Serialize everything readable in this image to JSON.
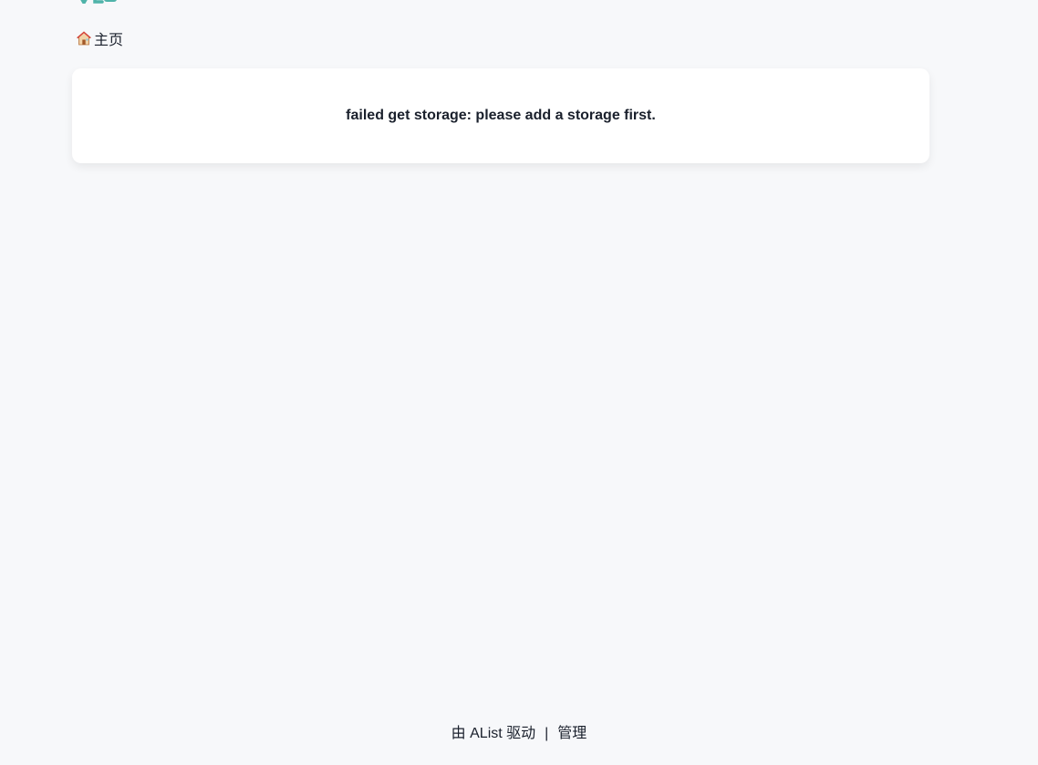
{
  "header": {
    "logo_icon": "alist-logo-icon",
    "accent_color": "#4fb3a9"
  },
  "breadcrumb": {
    "home_icon": "house-icon",
    "home_label": "主页"
  },
  "main": {
    "error_message": "failed get storage: please add a storage first."
  },
  "footer": {
    "powered_by": "由 AList 驱动",
    "separator": "|",
    "manage_label": "管理"
  }
}
